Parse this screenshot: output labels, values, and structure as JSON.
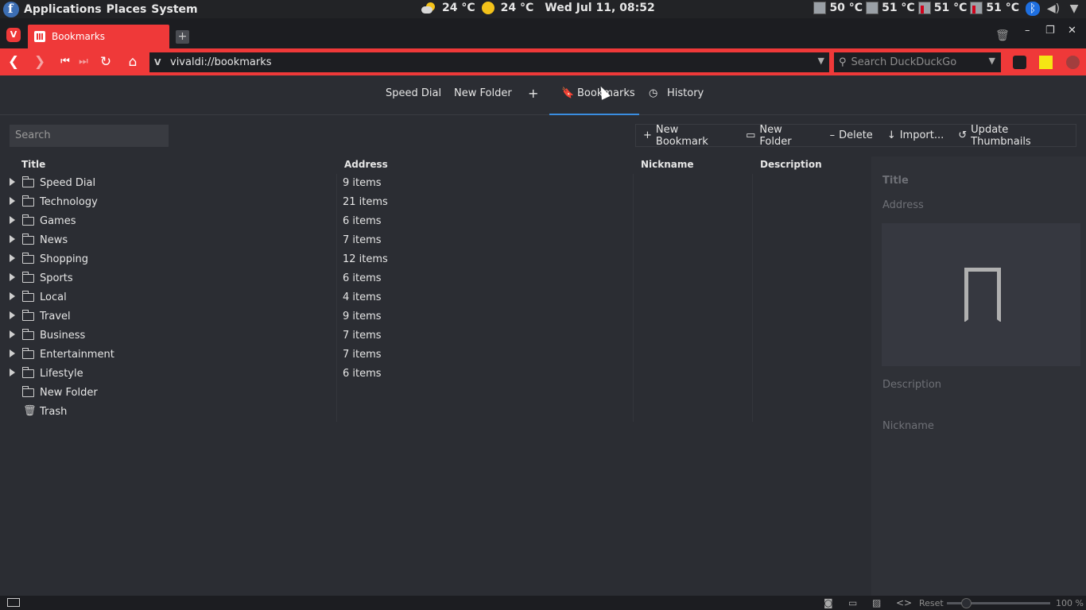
{
  "system_bar": {
    "menus": [
      "Applications",
      "Places",
      "System"
    ],
    "weather1": "24 °C",
    "weather2": "24 °C",
    "datetime": "Wed Jul 11, 08:52",
    "temps": [
      "50 °C",
      "51 °C",
      "51 °C",
      "51 °C"
    ]
  },
  "tab": {
    "title": "Bookmarks"
  },
  "address": {
    "url": "vivaldi://bookmarks",
    "search_placeholder": "Search DuckDuckGo"
  },
  "panel_nav": {
    "speed_dial": "Speed Dial",
    "new_folder": "New Folder",
    "add": "+",
    "bookmarks": "Bookmarks",
    "history": "History"
  },
  "toolbar": {
    "search_placeholder": "Search",
    "new_bookmark": "New Bookmark",
    "new_folder": "New Folder",
    "delete": "Delete",
    "import": "Import...",
    "update_thumbnails": "Update Thumbnails"
  },
  "table": {
    "headers": {
      "title": "Title",
      "address": "Address",
      "nickname": "Nickname",
      "description": "Description"
    },
    "rows": [
      {
        "title": "Speed Dial",
        "address": "9 items"
      },
      {
        "title": "Technology",
        "address": "21 items"
      },
      {
        "title": "Games",
        "address": "6 items"
      },
      {
        "title": "News",
        "address": "7 items"
      },
      {
        "title": "Shopping",
        "address": "12 items"
      },
      {
        "title": "Sports",
        "address": "6 items"
      },
      {
        "title": "Local",
        "address": "4 items"
      },
      {
        "title": "Travel",
        "address": "9 items"
      },
      {
        "title": "Business",
        "address": "7 items"
      },
      {
        "title": "Entertainment",
        "address": "7 items"
      },
      {
        "title": "Lifestyle",
        "address": "6 items"
      },
      {
        "title": "New Folder",
        "address": ""
      },
      {
        "title": "Trash",
        "address": ""
      }
    ]
  },
  "details": {
    "title": "Title",
    "address": "Address",
    "description": "Description",
    "nickname": "Nickname"
  },
  "status": {
    "reset": "Reset",
    "zoom": "100 %"
  }
}
